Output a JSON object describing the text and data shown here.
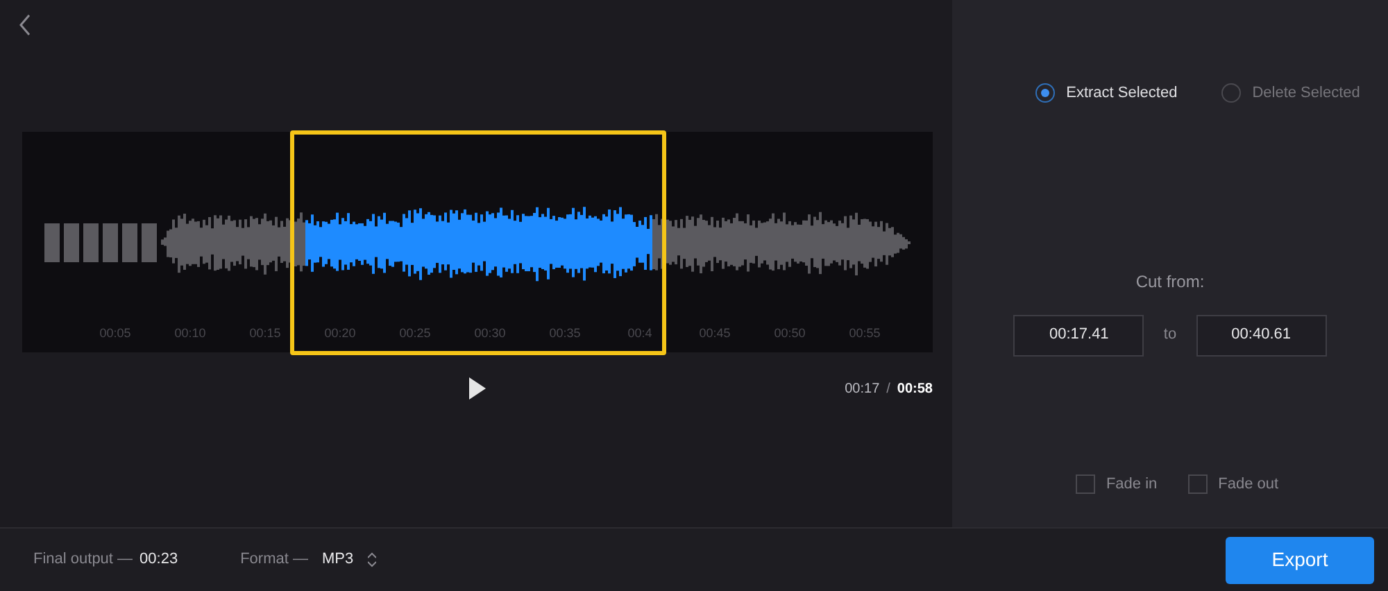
{
  "timeline": {
    "ticks": [
      "00:05",
      "00:10",
      "00:15",
      "00:20",
      "00:25",
      "00:30",
      "00:35",
      "00:4",
      "00:45",
      "00:50",
      "00:55"
    ]
  },
  "player": {
    "current": "00:17",
    "separator": "/",
    "total": "00:58"
  },
  "mode_options": [
    {
      "label": "Extract Selected",
      "selected": true
    },
    {
      "label": "Delete Selected",
      "selected": false
    }
  ],
  "cut": {
    "title": "Cut from:",
    "start": "00:17.41",
    "joiner": "to",
    "end": "00:40.61"
  },
  "fades": [
    {
      "label": "Fade in",
      "checked": false
    },
    {
      "label": "Fade out",
      "checked": false
    }
  ],
  "footer": {
    "output_label": "Final output —",
    "output_value": "00:23",
    "format_label": "Format —",
    "format_value": "MP3",
    "export": "Export"
  }
}
